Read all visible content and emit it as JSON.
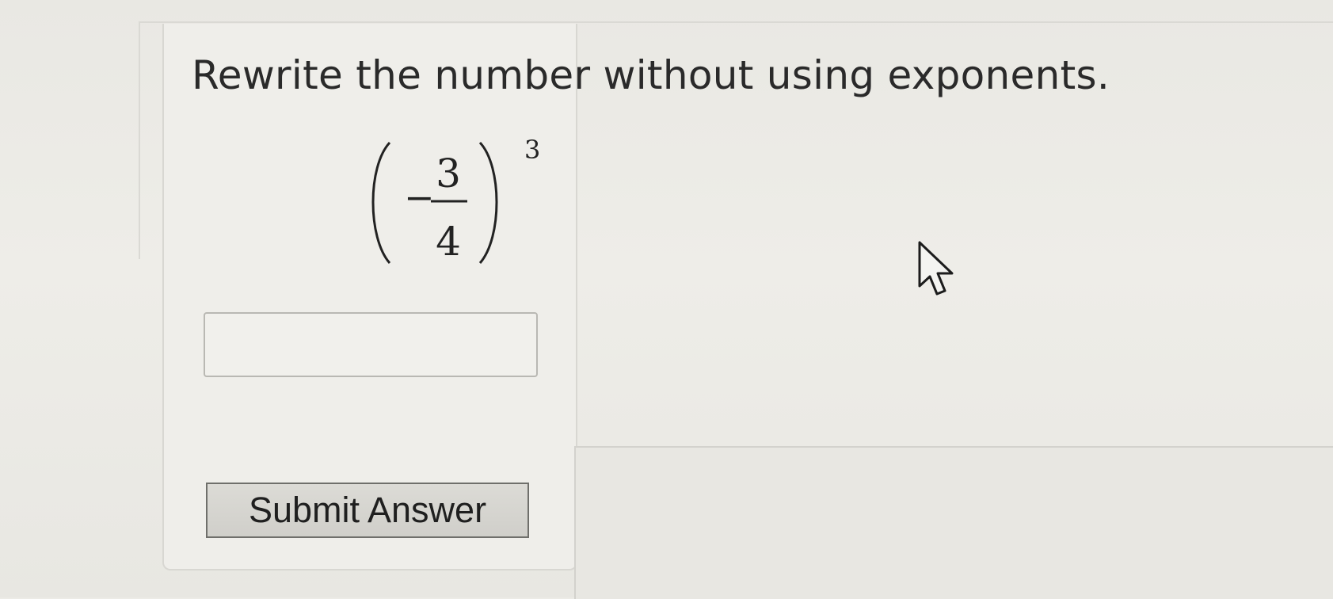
{
  "question": {
    "prompt": "Rewrite the number without using exponents.",
    "expression": {
      "sign": "−",
      "numerator": "3",
      "denominator": "4",
      "exponent": "3"
    }
  },
  "answer_field": {
    "value": "",
    "placeholder": ""
  },
  "submit_button": {
    "label": "Submit Answer"
  },
  "icons": {
    "cursor": "mouse-pointer-arrow-icon"
  }
}
